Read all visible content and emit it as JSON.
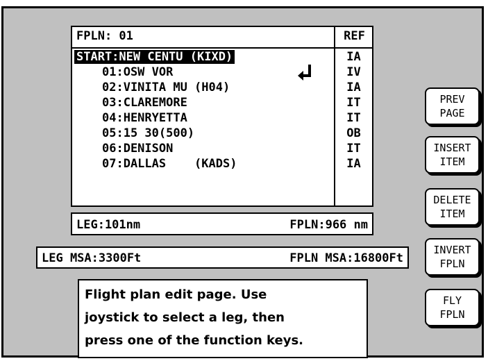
{
  "fpln_table": {
    "title": "FPLN: 01",
    "ref_header": "REF",
    "start_row": {
      "label": "START:NEW CENTU (KIXD)",
      "ref": "IA"
    },
    "legs": [
      {
        "label": "01:OSW VOR",
        "ref": "IV"
      },
      {
        "label": "02:VINITA MU (H04)",
        "ref": "IA"
      },
      {
        "label": "03:CLAREMORE",
        "ref": "IT"
      },
      {
        "label": "04:HENRYETTA",
        "ref": "IT"
      },
      {
        "label": "05:15 30(500)",
        "ref": "OB"
      },
      {
        "label": "06:DENISON",
        "ref": "IT"
      },
      {
        "label": "07:DALLAS    (KADS)",
        "ref": "IA"
      }
    ],
    "arrow_icon": "return-arrow-icon"
  },
  "distance": {
    "leg": "LEG:101nm",
    "fpln": "FPLN:966 nm"
  },
  "msa": {
    "leg": "LEG MSA:3300Ft",
    "fpln": "FPLN MSA:16800Ft"
  },
  "help": {
    "lines": [
      "Flight plan edit page. Use",
      "joystick to select a leg, then",
      "press one of the function keys."
    ]
  },
  "function_keys": [
    {
      "line1": "PREV",
      "line2": "PAGE"
    },
    {
      "line1": "INSERT",
      "line2": "ITEM"
    },
    {
      "line1": "DELETE",
      "line2": "ITEM"
    },
    {
      "line1": "INVERT",
      "line2": "FPLN"
    },
    {
      "line1": "FLY",
      "line2": "FPLN"
    }
  ]
}
